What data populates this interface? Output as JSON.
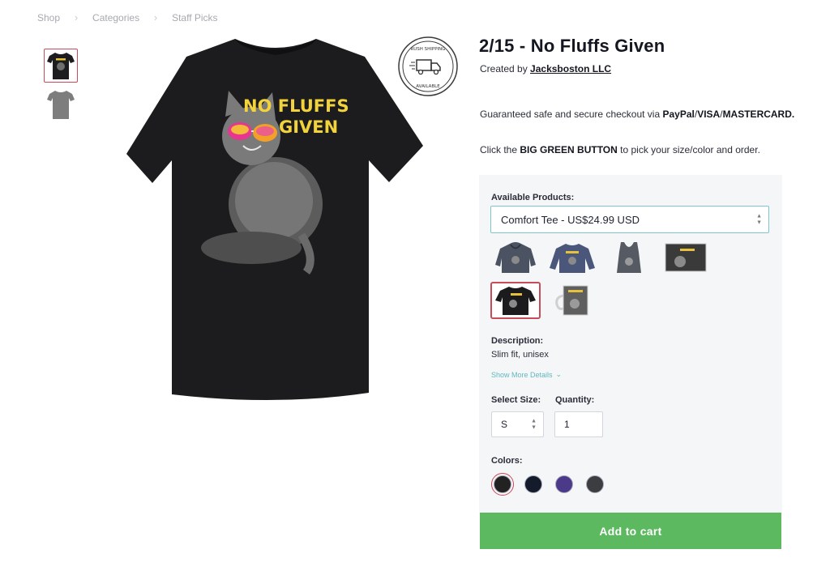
{
  "breadcrumb": [
    "Shop",
    "Categories",
    "Staff Picks"
  ],
  "product": {
    "title": "2/15 - No Fluffs Given",
    "created_by_prefix": "Created by",
    "creator": "Jacksboston LLC",
    "shirt_text_line1": "NO FLUFFS",
    "shirt_text_line2": "GIVEN"
  },
  "badge": {
    "text_top": "RUSH SHIPPING",
    "text_bottom": "AVAILABLE"
  },
  "checkout": {
    "prefix": "Guaranteed safe and secure checkout via ",
    "paypal": "PayPal",
    "slash1": "/",
    "visa": "VISA",
    "slash2": "/",
    "mastercard": "MASTERCARD.",
    "instruction_prefix": "Click the ",
    "instruction_bold": "BIG GREEN BUTTON",
    "instruction_suffix": " to pick your size/color and order."
  },
  "options": {
    "available_label": "Available Products:",
    "selected_product": "Comfort Tee - US$24.99 USD",
    "product_thumbnails": [
      "hoodie-icon",
      "sweatshirt-icon",
      "tank-top-icon",
      "poster-icon",
      "tshirt-icon",
      "mug-icon"
    ],
    "description_label": "Description:",
    "description_value": "Slim fit, unisex",
    "show_more": "Show More Details",
    "size_label": "Select Size:",
    "size_value": "S",
    "quantity_label": "Quantity:",
    "quantity_value": "1",
    "colors_label": "Colors:",
    "colors": [
      "#222222",
      "#141c2b",
      "#4b3a8a",
      "#3c3d40"
    ]
  },
  "cart": {
    "button_label": "Add to cart",
    "button_color": "#5cb95f"
  }
}
